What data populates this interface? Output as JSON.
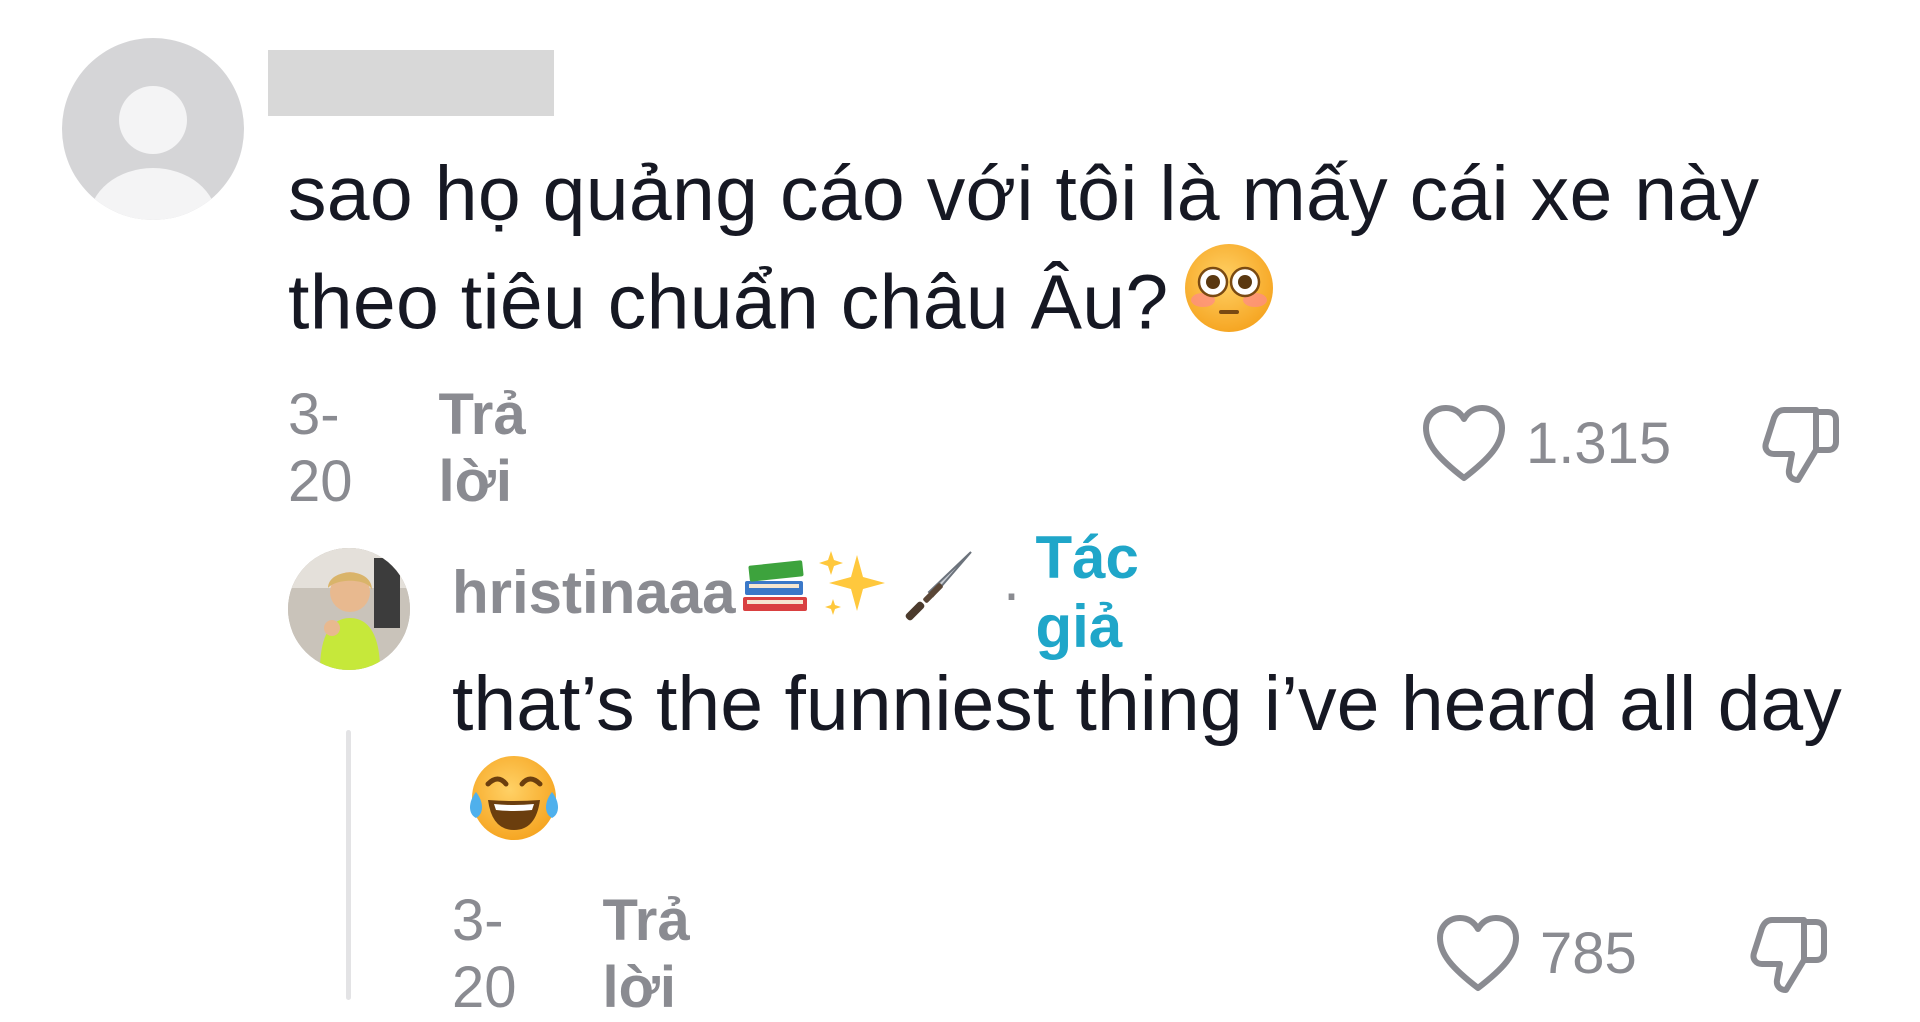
{
  "comment": {
    "text": "sao họ quảng cáo với tôi là mấy cái xe này theo tiêu chuẩn châu Âu?",
    "emoji_icon": "flushed-face-emoji",
    "date": "3-20",
    "reply_label": "Trả lời",
    "likes": "1.315"
  },
  "reply_comment": {
    "username": "hristinaaa",
    "username_emojis": [
      "books-emoji",
      "sparkles-emoji",
      "dagger-emoji"
    ],
    "separator": "·",
    "author_label": "Tác giả",
    "text": "that’s the funniest thing i’ve heard all day",
    "emoji_icon": "tears-of-joy-emoji",
    "date": "3-20",
    "reply_label": "Trả lời",
    "likes": "785"
  },
  "colors": {
    "text": "#161823",
    "muted": "#8a8b91",
    "author": "#1fa6c9",
    "redacted": "#d8d8d8",
    "thread_line": "#e3e3e5"
  }
}
